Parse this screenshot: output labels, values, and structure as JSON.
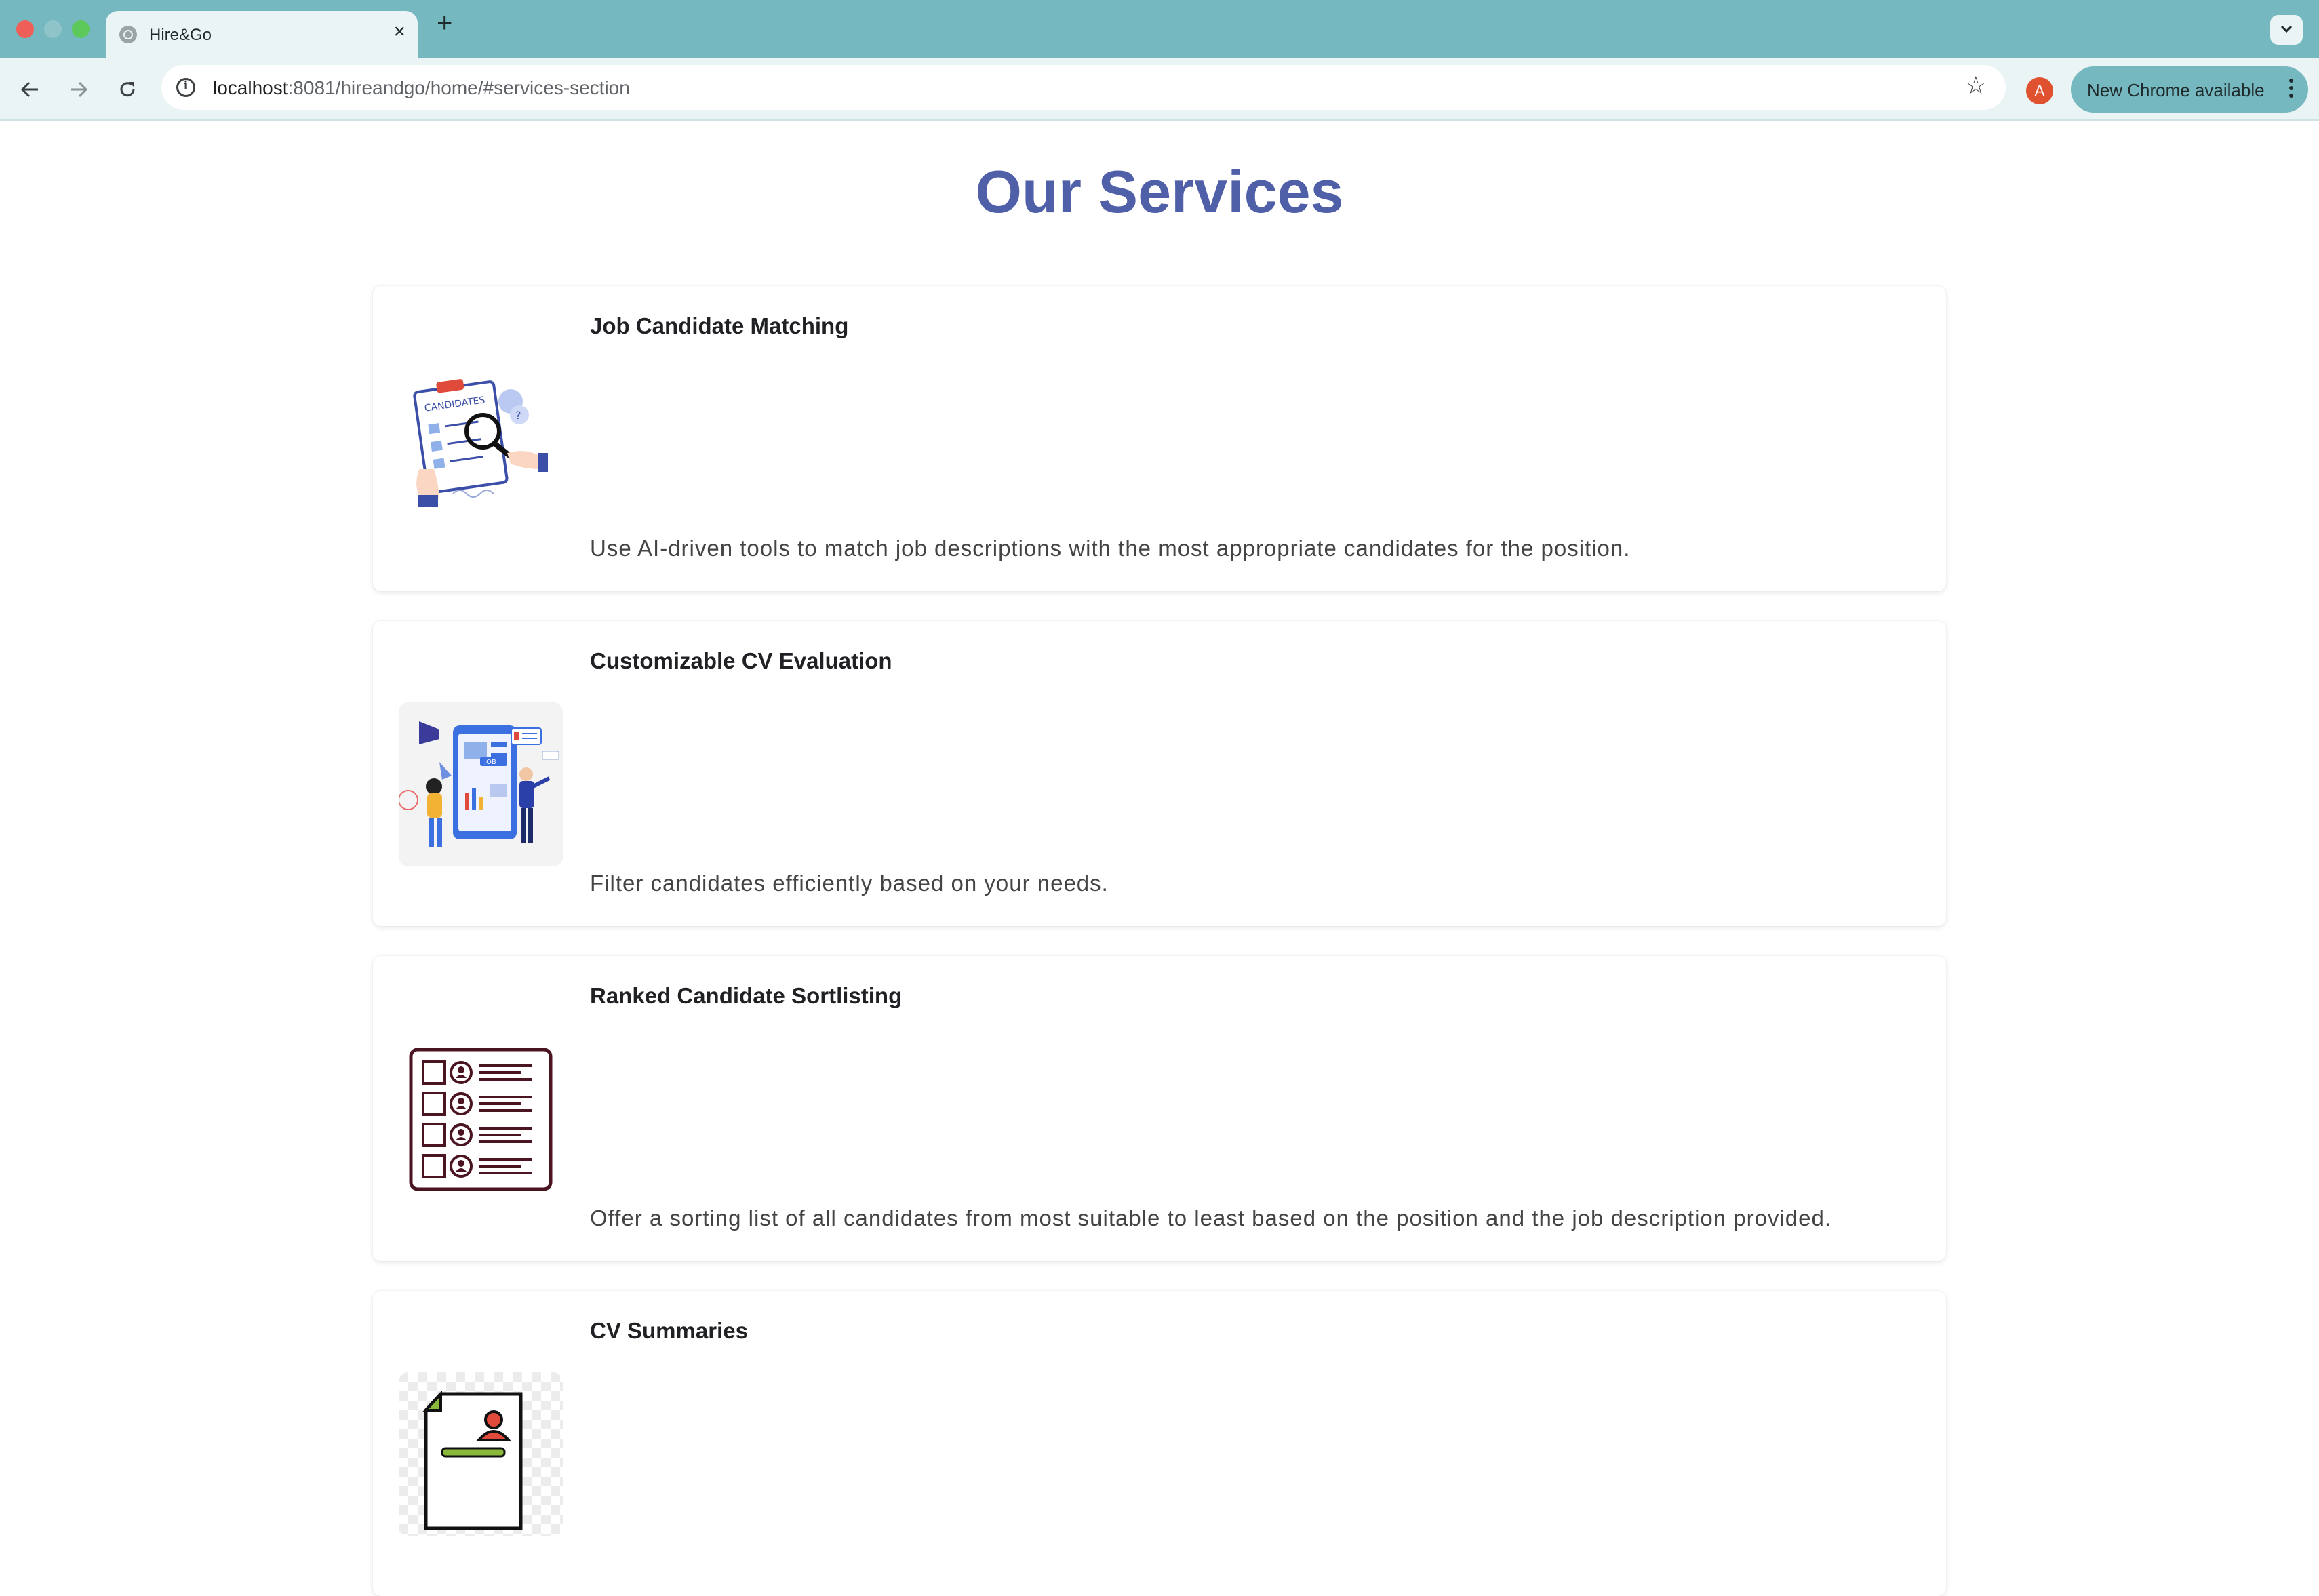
{
  "browser": {
    "tab_title": "Hire&Go",
    "url_host": "localhost",
    "url_rest": ":8081/hireandgo/home/#services-section",
    "profile_initial": "A",
    "update_label": "New Chrome available"
  },
  "section": {
    "title": "Our Services"
  },
  "services": [
    {
      "title": "Job Candidate Matching",
      "description": "Use AI-driven tools to match job descriptions with the most appropriate candidates for the position.",
      "image_label": "CANDIDATES",
      "icon": "candidate-search-illustration"
    },
    {
      "title": "Customizable CV Evaluation",
      "description": "Filter candidates efficiently based on your needs.",
      "image_label": "JOB",
      "icon": "cv-evaluation-illustration"
    },
    {
      "title": "Ranked Candidate Sortlisting",
      "description": "Offer a sorting list of all candidates from most suitable to least based on the position and the job description provided.",
      "icon": "ranked-list-icon"
    },
    {
      "title": "CV Summaries",
      "description": "",
      "icon": "cv-document-icon"
    }
  ],
  "colors": {
    "tab_strip": "#75b8bf",
    "toolbar": "#eaf4f5",
    "title_accent": "#4f5fa8"
  }
}
